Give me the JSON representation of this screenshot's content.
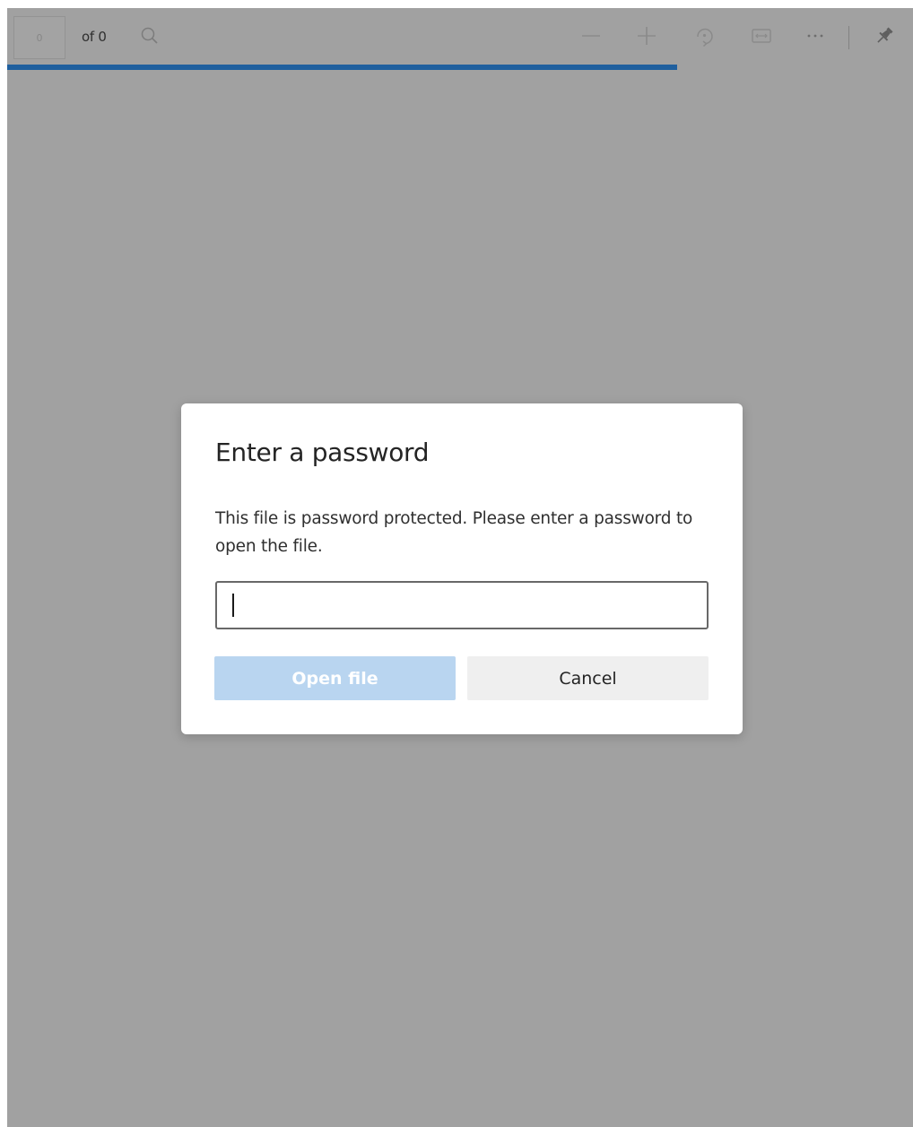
{
  "toolbar": {
    "page_number": "0",
    "page_count": "of 0",
    "icons": {
      "search": "search-icon",
      "zoom_out": "minus-icon",
      "zoom_in": "plus-icon",
      "rotate": "rotate-icon",
      "fit": "fit-width-icon",
      "more": "more-icon",
      "pin": "pin-icon"
    }
  },
  "loading": {
    "progress": 0.74,
    "color": "#1f5f9e"
  },
  "dialog": {
    "title": "Enter a password",
    "message": "This file is password protected. Please enter a password to open the file.",
    "password_value": "",
    "open_label": "Open file",
    "cancel_label": "Cancel"
  },
  "colors": {
    "backdrop": "#a1a1a1",
    "accent_disabled": "#b9d5f0"
  }
}
